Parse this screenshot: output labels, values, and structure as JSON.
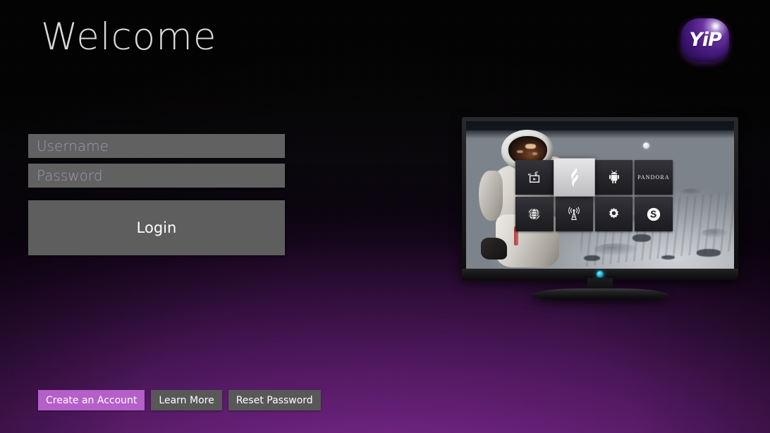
{
  "page": {
    "title": "Welcome",
    "background_top_color": "#070707",
    "background_bottom_color": "#8b2ea0"
  },
  "logo": {
    "text": "YiP",
    "name": "yip-logo",
    "brand_color": "#4b1d83"
  },
  "form": {
    "username": {
      "value": "",
      "placeholder": "Username"
    },
    "password": {
      "value": "",
      "placeholder": "Password"
    },
    "login_label": "Login",
    "field_color": "#616161",
    "placeholder_color": "#a294b0"
  },
  "bottom_buttons": [
    {
      "label": "Create an Account",
      "style": "primary",
      "color": "#b55fc9"
    },
    {
      "label": "Learn More",
      "style": "default",
      "color": "#585858"
    },
    {
      "label": "Reset Password",
      "style": "default",
      "color": "#585858"
    }
  ],
  "tv": {
    "name": "tv-preview",
    "wallpaper": "astronaut-on-the-moon",
    "led_color": "#1fb6d6",
    "tiles": [
      {
        "icon": "media-cast-icon",
        "label": "",
        "selected": false
      },
      {
        "icon": "flame-logo-icon",
        "label": "",
        "selected": true
      },
      {
        "icon": "android-icon",
        "label": "",
        "selected": false
      },
      {
        "icon": "pandora-icon",
        "label": "PANDORA",
        "selected": false
      },
      {
        "icon": "globe-icon",
        "label": "",
        "selected": false
      },
      {
        "icon": "broadcast-tower-icon",
        "label": "",
        "selected": false
      },
      {
        "icon": "gear-icon",
        "label": "",
        "selected": false
      },
      {
        "icon": "skype-icon",
        "label": "",
        "selected": false
      }
    ]
  }
}
